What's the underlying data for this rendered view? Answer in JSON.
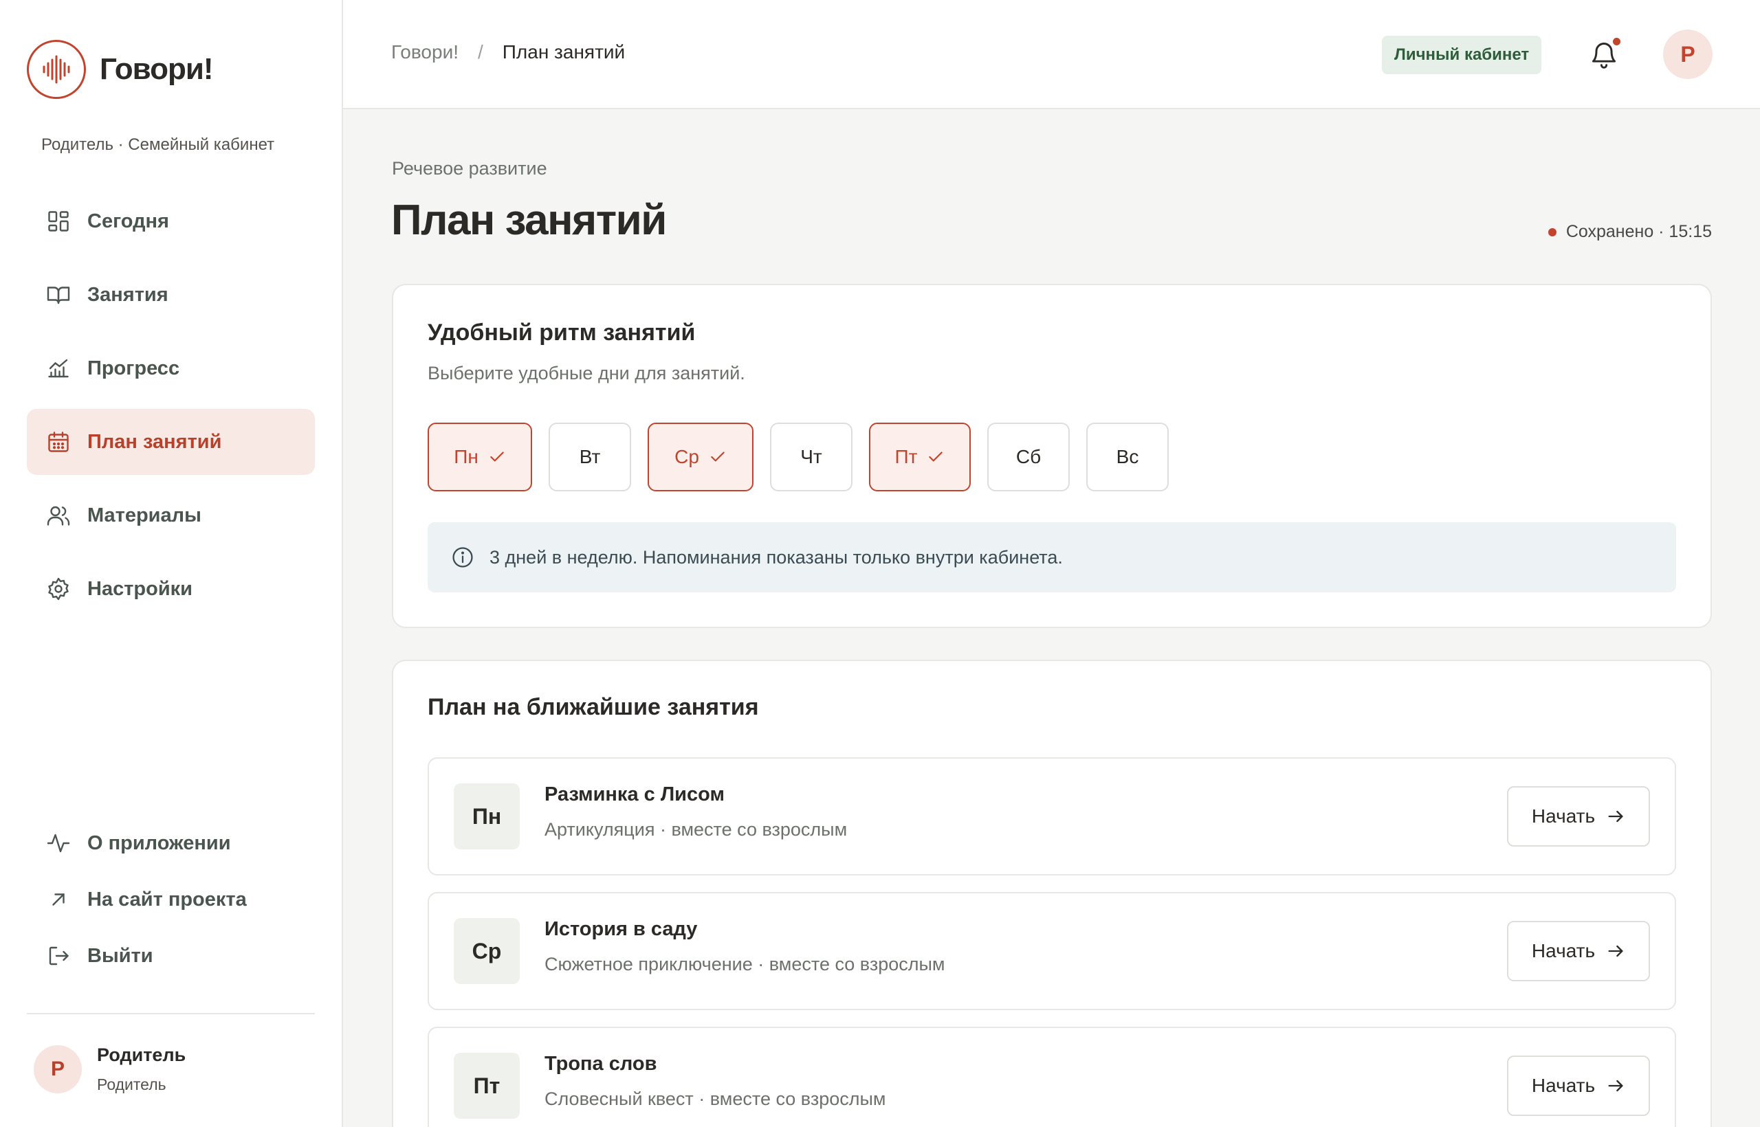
{
  "app": {
    "name": "Говори!",
    "role_line": "Родитель · Семейный кабинет"
  },
  "sidebar": {
    "items": [
      {
        "label": "Сегодня",
        "icon": "grid-icon",
        "active": false
      },
      {
        "label": "Занятия",
        "icon": "book-icon",
        "active": false
      },
      {
        "label": "Прогресс",
        "icon": "chart-icon",
        "active": false
      },
      {
        "label": "План занятий",
        "icon": "calendar-icon",
        "active": true
      },
      {
        "label": "Материалы",
        "icon": "users-icon",
        "active": false
      },
      {
        "label": "Настройки",
        "icon": "gear-icon",
        "active": false
      }
    ],
    "bottom_items": [
      {
        "label": "О приложении",
        "icon": "pulse-icon"
      },
      {
        "label": "На сайт проекта",
        "icon": "external-arrow-icon"
      },
      {
        "label": "Выйти",
        "icon": "logout-icon"
      }
    ],
    "user": {
      "initial": "Р",
      "name": "Родитель",
      "role": "Родитель"
    }
  },
  "header": {
    "breadcrumb_root": "Говори!",
    "breadcrumb_sep": "/",
    "breadcrumb_current": "План занятий",
    "cabinet_button": "Личный кабинет",
    "avatar_initial": "Р"
  },
  "page": {
    "eyebrow": "Речевое развитие",
    "title": "План занятий",
    "saved_status": "Сохранено · 15:15"
  },
  "rhythm": {
    "title": "Удобный ритм занятий",
    "subtitle": "Выберите удобные дни для занятий.",
    "days": [
      {
        "label": "Пн",
        "selected": true
      },
      {
        "label": "Вт",
        "selected": false
      },
      {
        "label": "Ср",
        "selected": true
      },
      {
        "label": "Чт",
        "selected": false
      },
      {
        "label": "Пт",
        "selected": true
      },
      {
        "label": "Сб",
        "selected": false
      },
      {
        "label": "Вс",
        "selected": false
      }
    ],
    "info": "3 дней в неделю. Напоминания показаны только внутри кабинета."
  },
  "plan": {
    "title": "План на ближайшие занятия",
    "lessons": [
      {
        "day": "Пн",
        "title": "Разминка с Лисом",
        "subtitle": "Артикуляция · вместе со взрослым",
        "button": "Начать"
      },
      {
        "day": "Ср",
        "title": "История в саду",
        "subtitle": "Сюжетное приключение · вместе со взрослым",
        "button": "Начать"
      },
      {
        "day": "Пт",
        "title": "Тропа слов",
        "subtitle": "Словесный квест · вместе со взрослым",
        "button": "Начать"
      }
    ]
  },
  "colors": {
    "accent": "#c2442c",
    "accent_bg": "#f8e9e5",
    "success_bg": "#e6f0e8",
    "info_bg": "#edf2f5"
  }
}
